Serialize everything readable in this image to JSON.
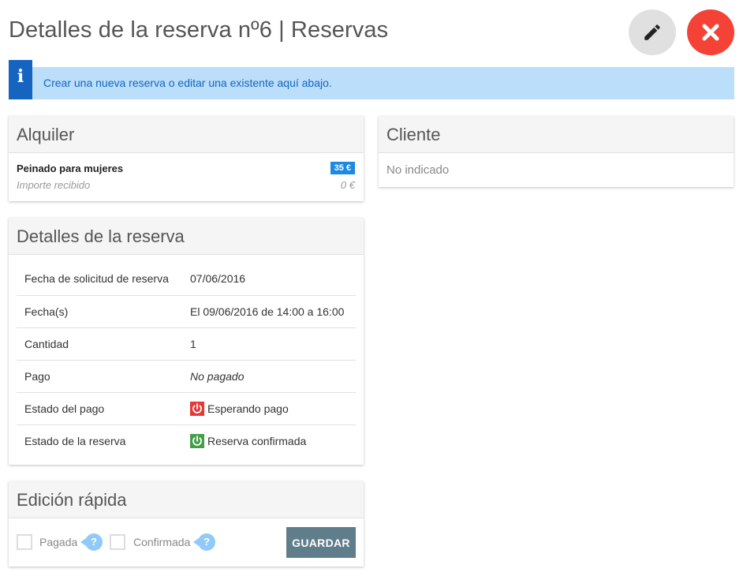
{
  "page": {
    "title": "Detalles de la reserva nº6 | Reservas"
  },
  "header_actions": {
    "edit_icon": "pencil-icon",
    "close_icon": "close-icon"
  },
  "info": {
    "icon": "info-icon",
    "text": "Crear una nueva reserva o editar una existente aquí abajo."
  },
  "alquiler": {
    "title": "Alquiler",
    "item_name": "Peinado para mujeres",
    "price": "35 €",
    "received_label": "Importe recibido",
    "received_value": "0 €"
  },
  "cliente": {
    "title": "Cliente",
    "value": "No indicado"
  },
  "detalles": {
    "title": "Detalles de la reserva",
    "rows": [
      {
        "label": "Fecha de solicitud de reserva",
        "value": "07/06/2016"
      },
      {
        "label": "Fecha(s)",
        "value": "El 09/06/2016 de 14:00 a 16:00"
      },
      {
        "label": "Cantidad",
        "value": "1"
      },
      {
        "label": "Pago",
        "value": "No pagado"
      },
      {
        "label": "Estado del pago",
        "value": "Esperando pago",
        "icon": "power-icon",
        "color": "#e53935"
      },
      {
        "label": "Estado de la reserva",
        "value": "Reserva confirmada",
        "icon": "power-icon",
        "color": "#43a047"
      }
    ]
  },
  "edicion": {
    "title": "Edición rápida",
    "paid_label": "Pagada",
    "confirmed_label": "Confirmada",
    "help": "?",
    "save_label": "GUARDAR"
  },
  "colors": {
    "info_bg": "#bbdefb",
    "info_accent": "#1565c0",
    "price_badge": "#1e88e5",
    "save_button": "#607d8b",
    "close_button": "#f44336"
  }
}
